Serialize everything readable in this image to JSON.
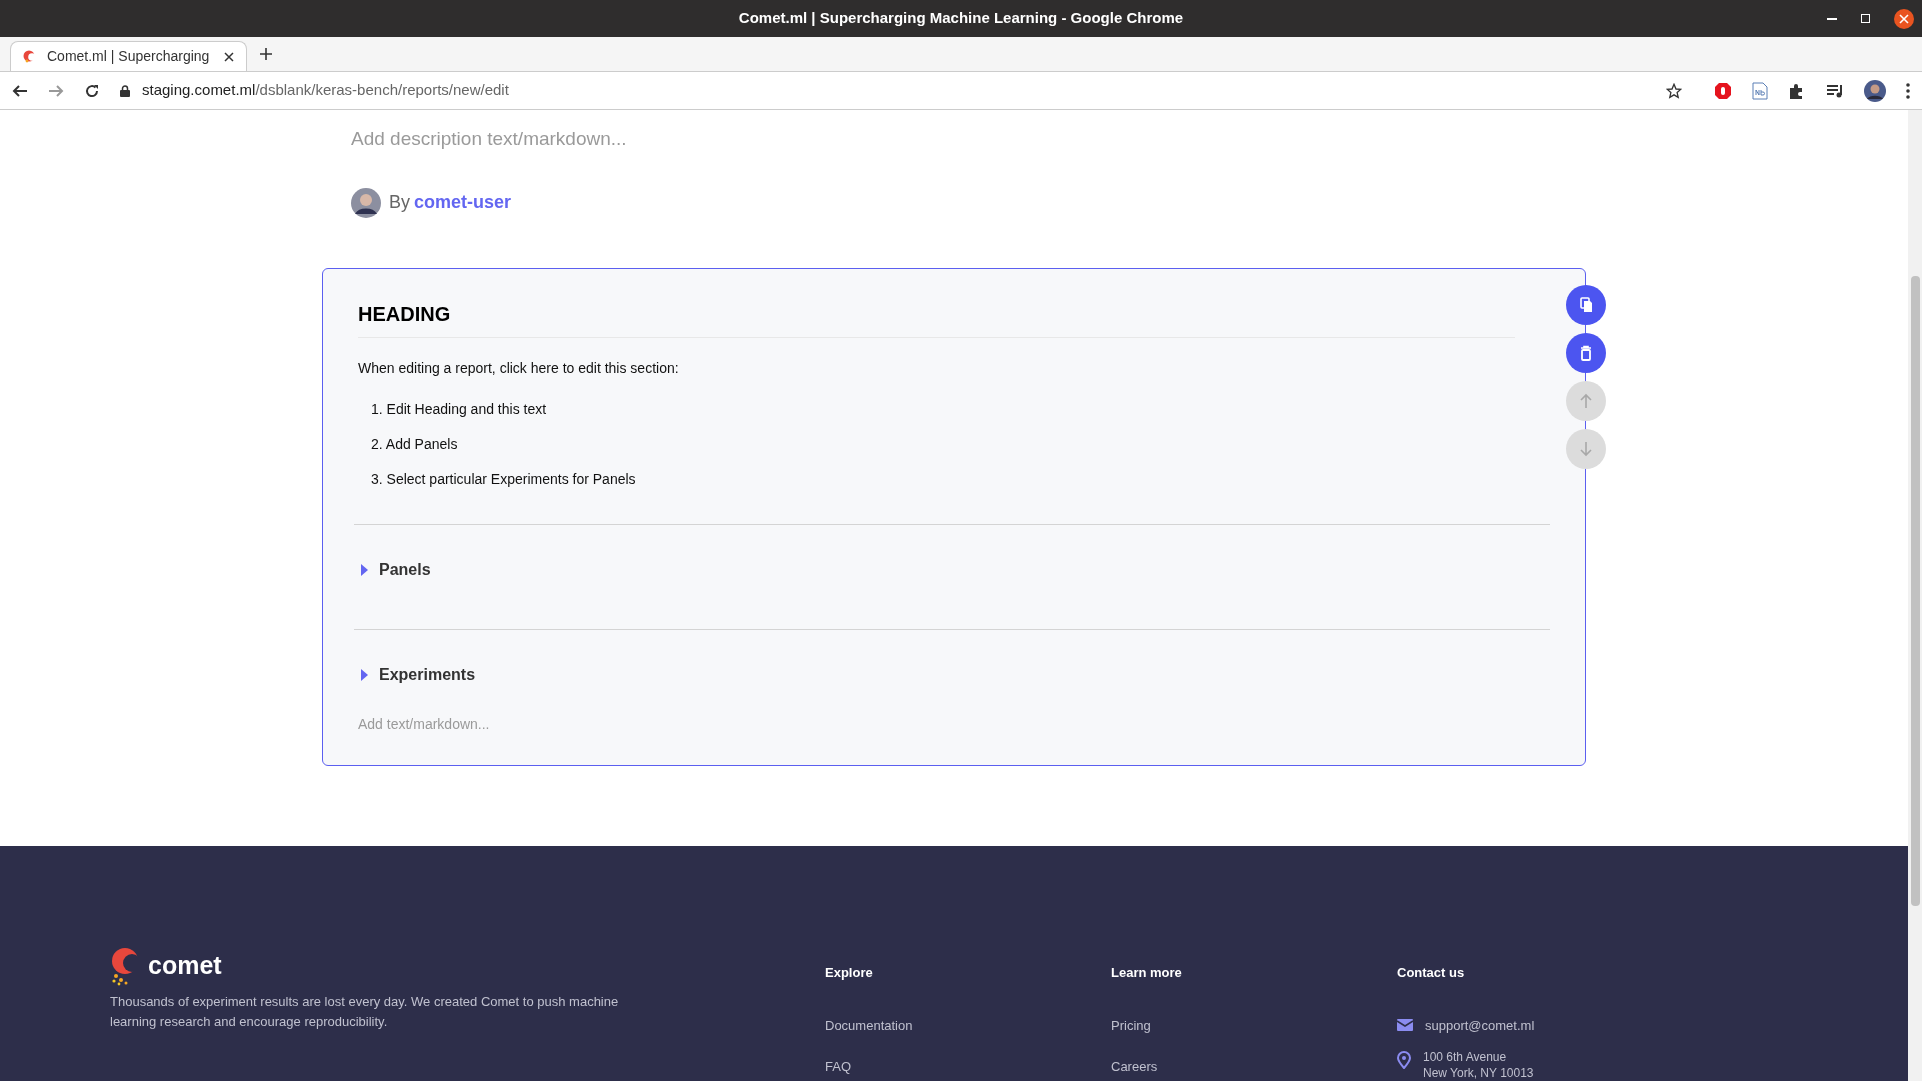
{
  "window": {
    "title": "Comet.ml | Supercharging Machine Learning - Google Chrome"
  },
  "tabs": [
    {
      "label": "Comet.ml | Supercharging",
      "selected": true
    }
  ],
  "address_bar": {
    "host": "staging.comet.ml",
    "path": "/dsblank/keras-bench/reports/new/edit"
  },
  "report": {
    "description": {
      "placeholder": "Add description text/markdown..."
    },
    "byline": "By",
    "author": "comet-user",
    "section": {
      "heading": "HEADING",
      "intro": "When editing a report, click here to edit this section:",
      "steps": [
        "1. Edit Heading and this text",
        "2. Add Panels",
        "3. Select particular Experiments for Panels"
      ],
      "groups": [
        {
          "label": "Panels",
          "expanded": false
        },
        {
          "label": "Experiments",
          "expanded": false
        }
      ],
      "text": {
        "placeholder": "Add text/markdown..."
      },
      "actions": [
        {
          "kind": "copy",
          "disabled": false
        },
        {
          "kind": "delete",
          "disabled": false
        },
        {
          "kind": "up",
          "disabled": true
        },
        {
          "kind": "down",
          "disabled": true
        }
      ]
    }
  },
  "footer": {
    "brand": "comet",
    "blurb": "Thousands of experiment results are lost every day. We created Comet to push machine learning research and encourage reproducibility.",
    "columns": [
      {
        "title": "Explore",
        "links": [
          "Documentation",
          "FAQ"
        ]
      },
      {
        "title": "Learn more",
        "links": [
          "Pricing",
          "Careers"
        ]
      }
    ],
    "contact": {
      "title": "Contact us",
      "email": "support@comet.ml",
      "address": [
        "100 6th Avenue",
        "New York, NY 10013"
      ]
    }
  }
}
